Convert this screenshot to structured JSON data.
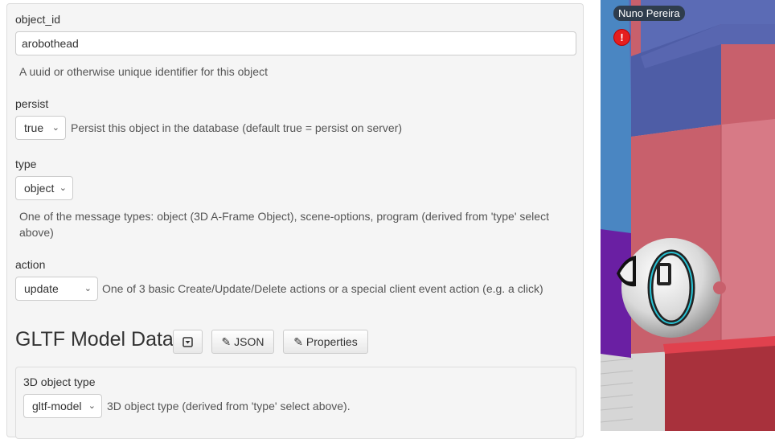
{
  "form": {
    "object_id": {
      "label": "object_id",
      "value": "arobothead",
      "help": "A uuid or otherwise unique identifier for this object"
    },
    "persist": {
      "label": "persist",
      "selected": "true",
      "help": "Persist this object in the database (default true = persist on server)"
    },
    "type": {
      "label": "type",
      "selected": "object",
      "help_line1": "One of the message types: object (3D A-Frame Object), scene-options, program (derived from 'type' select",
      "help_line2": "above)"
    },
    "action": {
      "label": "action",
      "selected": "update",
      "help": "One of 3 basic Create/Update/Delete actions or a special client event action (e.g. a click)"
    }
  },
  "section": {
    "title": "GLTF Model Data",
    "toggle_icon": "collapse-toggle-icon",
    "json_label": "JSON",
    "properties_label": "Properties",
    "edit_icon": "pencil-icon"
  },
  "subform": {
    "object_type": {
      "label": "3D object type",
      "selected": "gltf-model",
      "help": "3D object type (derived from 'type' select above)."
    }
  },
  "scene": {
    "user_badge": "Nuno Pereira",
    "alert_icon": "!",
    "colors": {
      "sky": "#5b6bb5",
      "pink_wall": "#c8606c",
      "red_block": "#d0313c",
      "purple_wall": "#6a1fa3",
      "blue_wall": "#4a86c2"
    }
  }
}
